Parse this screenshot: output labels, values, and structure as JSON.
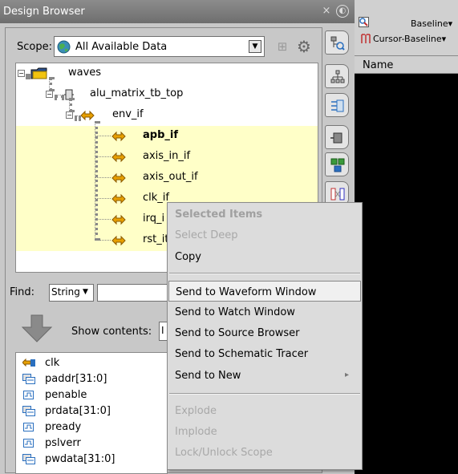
{
  "design_browser": {
    "title": "Design Browser",
    "close_glyph": "×",
    "float_glyph": "④",
    "scope_label": "Scope:",
    "scope_value": "All Available Data",
    "tree": [
      {
        "label": "waves",
        "level": 0,
        "icon": "folder-icon"
      },
      {
        "label": "alu_matrix_tb_top",
        "level": 1,
        "icon": "module-icon"
      },
      {
        "label": "env_if",
        "level": 2,
        "icon": "interface-icon"
      },
      {
        "label": "apb_if",
        "level": 3,
        "icon": "interface-icon",
        "selected": true,
        "bold": true
      },
      {
        "label": "axis_in_if",
        "level": 3,
        "icon": "interface-icon",
        "selected": true
      },
      {
        "label": "axis_out_if",
        "level": 3,
        "icon": "interface-icon",
        "selected": true
      },
      {
        "label": "clk_if",
        "level": 3,
        "icon": "interface-icon",
        "selected": true
      },
      {
        "label": "irq_i",
        "level": 3,
        "icon": "interface-icon",
        "selected": true
      },
      {
        "label": "rst_it",
        "level": 3,
        "icon": "interface-icon",
        "selected": true
      }
    ],
    "find_label": "Find:",
    "find_mode": "String",
    "find_value": "",
    "show_contents_label": "Show contents:",
    "show_contents_value": "I",
    "signals": [
      {
        "label": "clk",
        "icon": "clock-signal-icon"
      },
      {
        "label": "paddr[31:0]",
        "icon": "bus-signal-icon"
      },
      {
        "label": "penable",
        "icon": "signal-icon"
      },
      {
        "label": "prdata[31:0]",
        "icon": "bus-signal-icon"
      },
      {
        "label": "pready",
        "icon": "signal-icon"
      },
      {
        "label": "pslverr",
        "icon": "signal-icon"
      },
      {
        "label": "pwdata[31:0]",
        "icon": "bus-signal-icon"
      }
    ]
  },
  "waveform": {
    "baseline_label": "Baseline▾",
    "cursor_baseline_label": "Cursor-Baseline▾",
    "name_column": "Name"
  },
  "context_menu": {
    "items": [
      {
        "label": "Selected Items",
        "kind": "header"
      },
      {
        "label": "Select Deep",
        "kind": "disabled"
      },
      {
        "label": "Copy",
        "kind": "enabled"
      },
      {
        "kind": "separator"
      },
      {
        "label": "Send to Waveform Window",
        "kind": "enabled",
        "active": true
      },
      {
        "label": "Send to Watch Window",
        "kind": "enabled"
      },
      {
        "label": "Send to Source Browser",
        "kind": "enabled"
      },
      {
        "label": "Send to Schematic Tracer",
        "kind": "enabled"
      },
      {
        "label": "Send to New",
        "kind": "enabled",
        "submenu": true
      },
      {
        "kind": "separator"
      },
      {
        "label": "Explode",
        "kind": "disabled"
      },
      {
        "label": "Implode",
        "kind": "disabled"
      },
      {
        "label": "Lock/Unlock Scope",
        "kind": "disabled"
      }
    ]
  },
  "colors": {
    "selection_bg": "#ffffc8",
    "interface_icon": "#e8a000",
    "titlebar": "#7a7a7a"
  }
}
